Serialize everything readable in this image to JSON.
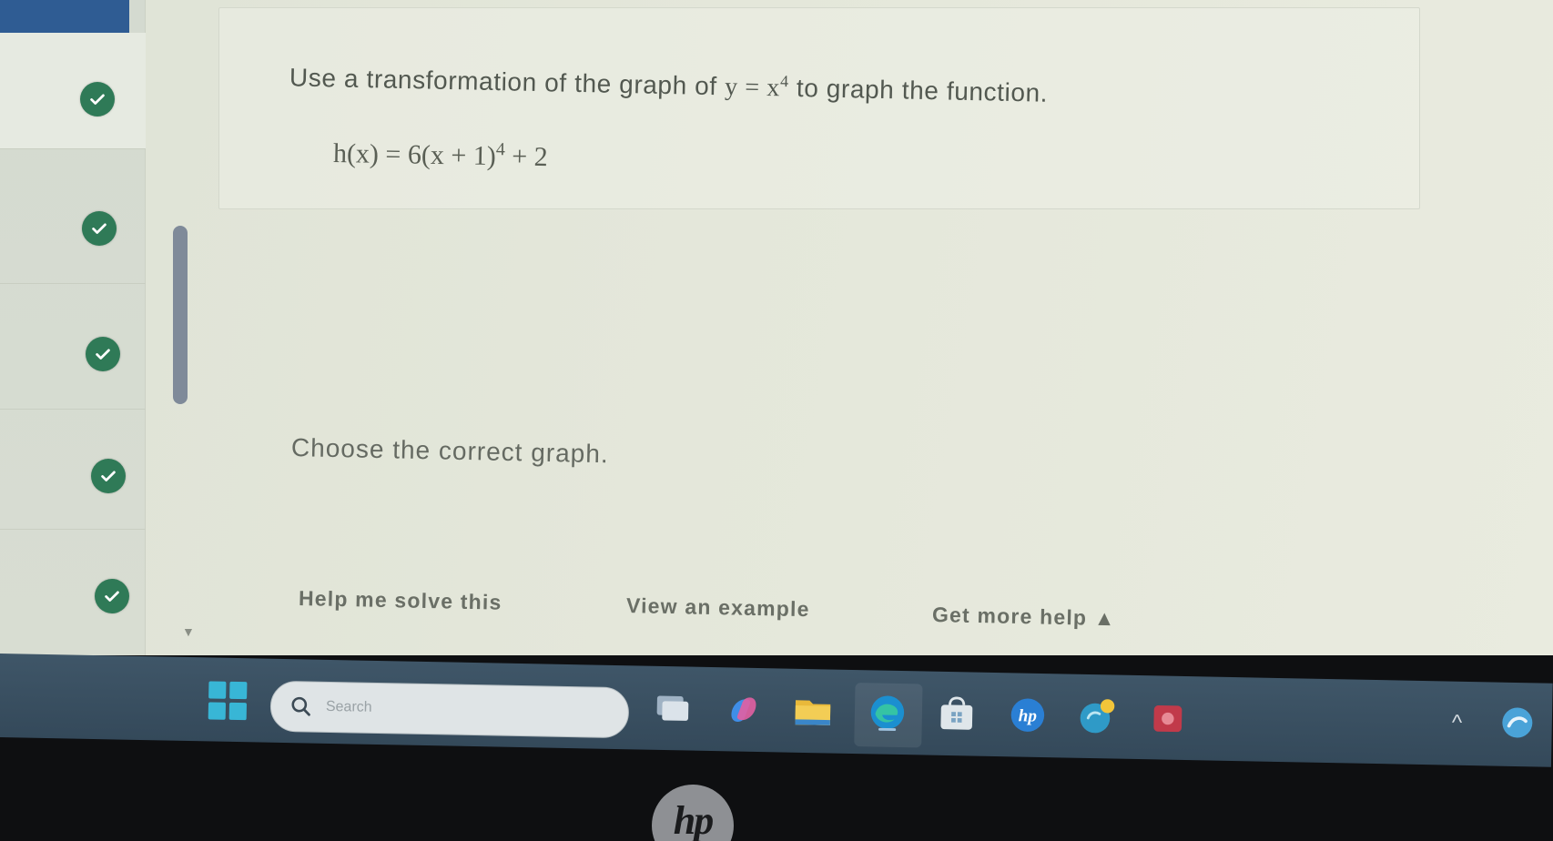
{
  "question": {
    "instruction_before": "Use a transformation of the graph of ",
    "base_function": "y = x",
    "base_exponent": "4",
    "instruction_after": " to graph the function.",
    "function_before": "h(x) = 6(x + 1)",
    "function_exponent": "4",
    "function_after": " + 2",
    "prompt": "Choose the correct graph."
  },
  "help": {
    "solve_label": "Help me solve this",
    "example_label": "View an example",
    "more_label": "Get more help ▲"
  },
  "sidebar": {
    "items": [
      {
        "status": "complete"
      },
      {
        "status": "complete"
      },
      {
        "status": "complete"
      },
      {
        "status": "complete"
      },
      {
        "status": "complete"
      }
    ]
  },
  "taskbar": {
    "search_placeholder": "Search",
    "icons": [
      "windows-start-icon",
      "search-icon",
      "task-view-icon",
      "copilot-icon",
      "file-explorer-icon",
      "edge-browser-icon",
      "store-icon",
      "hp-app-icon",
      "chat-app-icon",
      "media-app-icon"
    ]
  },
  "bezel": {
    "logo": "hp"
  },
  "colors": {
    "check": "#2f7a57",
    "taskbar": "#3f5668",
    "accent": "#2f5c93"
  }
}
